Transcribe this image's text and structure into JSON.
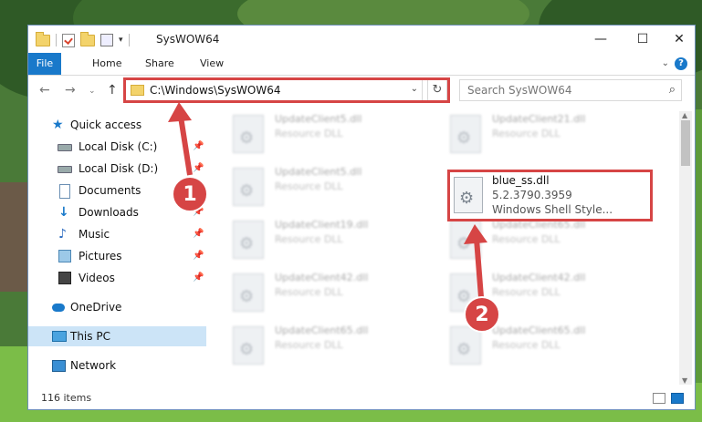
{
  "window": {
    "title": "SysWOW64",
    "controls": {
      "minimize": "—",
      "maximize": "☐",
      "close": "✕"
    }
  },
  "ribbon": {
    "tabs": [
      "File",
      "Home",
      "Share",
      "View"
    ]
  },
  "address_bar": {
    "path": "C:\\Windows\\SysWOW64"
  },
  "search": {
    "placeholder": "Search SysWOW64"
  },
  "sidebar": {
    "items": [
      {
        "label": "Quick access",
        "icon": "star-icon"
      },
      {
        "label": "Local Disk (C:)",
        "icon": "disk-icon"
      },
      {
        "label": "Local Disk (D:)",
        "icon": "disk-icon"
      },
      {
        "label": "Documents",
        "icon": "document-icon"
      },
      {
        "label": "Downloads",
        "icon": "download-icon"
      },
      {
        "label": "Music",
        "icon": "music-icon"
      },
      {
        "label": "Pictures",
        "icon": "pictures-icon"
      },
      {
        "label": "Videos",
        "icon": "videos-icon"
      },
      {
        "label": "OneDrive",
        "icon": "cloud-icon"
      },
      {
        "label": "This PC",
        "icon": "pc-icon"
      },
      {
        "label": "Network",
        "icon": "network-icon"
      }
    ]
  },
  "files": [
    {
      "name": "UpdateClient5.dll",
      "desc": "Resource DLL"
    },
    {
      "name": "UpdateClient21.dll",
      "desc": "Resource DLL"
    },
    {
      "name": "UpdateClient5.dll",
      "desc": "Resource DLL"
    },
    {
      "name": "UpdateClient19.dll",
      "desc": "Resource DLL"
    },
    {
      "name": "UpdateClient65.dll",
      "desc": "Resource DLL"
    },
    {
      "name": "UpdateClient42.dll",
      "desc": "Resource DLL"
    },
    {
      "name": "UpdateClient42.dll",
      "desc": "Resource DLL"
    },
    {
      "name": "UpdateClient65.dll",
      "desc": "Resource DLL"
    },
    {
      "name": "UpdateClient65.dll",
      "desc": "Resource DLL"
    }
  ],
  "highlighted_file": {
    "name": "blue_ss.dll",
    "version": "5.2.3790.3959",
    "description": "Windows Shell Style..."
  },
  "status": {
    "item_count": "116 items"
  },
  "callouts": [
    "1",
    "2"
  ],
  "colors": {
    "accent": "#1979ca",
    "callout": "#d64545"
  }
}
